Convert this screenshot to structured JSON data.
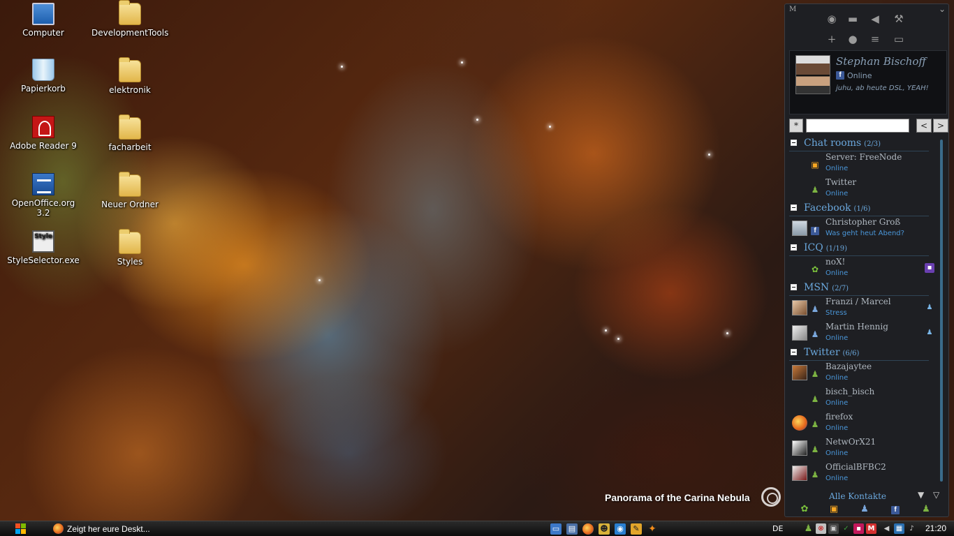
{
  "desktop": {
    "icons": [
      {
        "label": "Computer"
      },
      {
        "label": "DevelopmentTools"
      },
      {
        "label": "Papierkorb"
      },
      {
        "label": "elektronik"
      },
      {
        "label": "Adobe Reader 9"
      },
      {
        "label": "facharbeit"
      },
      {
        "label": "OpenOffice.org 3.2"
      },
      {
        "label": "Neuer Ordner"
      },
      {
        "label": "StyleSelector.exe"
      },
      {
        "label": "Styles"
      }
    ],
    "wallpaper_caption": "Panorama of the Carina Nebula"
  },
  "contact_list": {
    "profile": {
      "name": "Stephan Bischoff",
      "status": "Online",
      "message": "juhu, ab heute DSL, YEAH!"
    },
    "search": {
      "clear_label": "*",
      "prev_label": "<",
      "next_label": ">"
    },
    "groups": [
      {
        "title": "Chat rooms",
        "count": "(2/3)",
        "contacts": [
          {
            "name": "Server: FreeNode",
            "status": "Online"
          },
          {
            "name": "Twitter",
            "status": "Online"
          }
        ]
      },
      {
        "title": "Facebook",
        "count": "(1/6)",
        "contacts": [
          {
            "name": "Christopher Groß",
            "status": "Was geht heut Abend?"
          }
        ]
      },
      {
        "title": "ICQ",
        "count": "(1/19)",
        "contacts": [
          {
            "name": "noX!",
            "status": "Online"
          }
        ]
      },
      {
        "title": "MSN",
        "count": "(2/7)",
        "contacts": [
          {
            "name": "Franzi / Marcel",
            "status": "Stress"
          },
          {
            "name": "Martin Hennig",
            "status": "Online"
          }
        ]
      },
      {
        "title": "Twitter",
        "count": "(6/6)",
        "contacts": [
          {
            "name": "Bazajaytee",
            "status": "Online"
          },
          {
            "name": "bisch_bisch",
            "status": "Online"
          },
          {
            "name": "firefox",
            "status": "Online"
          },
          {
            "name": "NetwOrX21",
            "status": "Online"
          },
          {
            "name": "OfficialBFBC2",
            "status": "Online"
          }
        ]
      }
    ],
    "footer_label": "Alle Kontakte",
    "colors": {
      "accent": "#6aa7dc",
      "status_text": "#4a96d8",
      "background": "#1e1f23"
    }
  },
  "taskbar": {
    "task_label": "Zeigt her eure Deskt...",
    "language": "DE",
    "clock": "21:20"
  }
}
